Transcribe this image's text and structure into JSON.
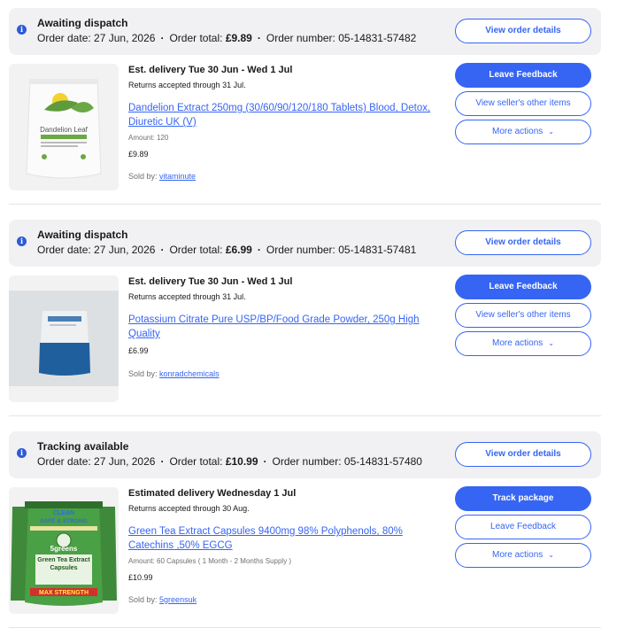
{
  "orders": [
    {
      "status": "Awaiting dispatch",
      "order_date_label": "Order date:",
      "order_date": "27 Jun, 2026",
      "order_total_label": "Order total:",
      "order_total": "£9.89",
      "order_number_label": "Order number:",
      "order_number": "05-14831-57482",
      "view_details": "View order details",
      "delivery": "Est. delivery Tue 30 Jun - Wed 1 Jul",
      "returns": "Returns accepted through 31 Jul.",
      "title": "Dandelion Extract 250mg (30/60/90/120/180 Tablets) Blood, Detox, Diuretic UK (V)",
      "spec": "Amount: 120",
      "price": "£9.89",
      "sold_by_label": "Sold by:",
      "seller": "vitaminute",
      "buttons": [
        "Leave Feedback",
        "View seller's other items",
        "More actions"
      ],
      "image_label": "Dandelion Leaf"
    },
    {
      "status": "Awaiting dispatch",
      "order_date_label": "Order date:",
      "order_date": "27 Jun, 2026",
      "order_total_label": "Order total:",
      "order_total": "£6.99",
      "order_number_label": "Order number:",
      "order_number": "05-14831-57481",
      "view_details": "View order details",
      "delivery": "Est. delivery Tue 30 Jun - Wed 1 Jul",
      "returns": "Returns accepted through 31 Jul.",
      "title": "Potassium Citrate Pure USP/BP/Food Grade Powder, 250g High Quality",
      "spec": "",
      "price": "£6.99",
      "sold_by_label": "Sold by:",
      "seller": "konradchemicals",
      "buttons": [
        "Leave Feedback",
        "View seller's other items",
        "More actions"
      ]
    },
    {
      "status": "Tracking available",
      "order_date_label": "Order date:",
      "order_date": "27 Jun, 2026",
      "order_total_label": "Order total:",
      "order_total": "£10.99",
      "order_number_label": "Order number:",
      "order_number": "05-14831-57480",
      "view_details": "View order details",
      "delivery": "Estimated delivery Wednesday 1 Jul",
      "returns": "Returns accepted through 30 Aug.",
      "title": "Green Tea Extract Capsules 9400mg 98% Polyphenols, 80% Catechins ,50% EGCG",
      "spec": "Amount: 60 Capsules ( 1 Month - 2 Months Supply )",
      "price": "£10.99",
      "sold_by_label": "Sold by:",
      "seller": "5greensuk",
      "buttons": [
        "Track package",
        "Leave Feedback",
        "More actions"
      ],
      "image_label_top": "CLEAN",
      "image_label_2": "SAFE & STRONG",
      "image_label_brand": "5greens",
      "image_label_product": "Green Tea Extract Capsules",
      "image_label_bottom": "MAX STRENGTH"
    }
  ],
  "icons": {
    "info": "info-icon",
    "chevron": "chevron-down-icon"
  },
  "colors": {
    "accent": "#3665f3",
    "header_bg": "#f1f1f3",
    "info_icon": "#2d5bd7"
  }
}
